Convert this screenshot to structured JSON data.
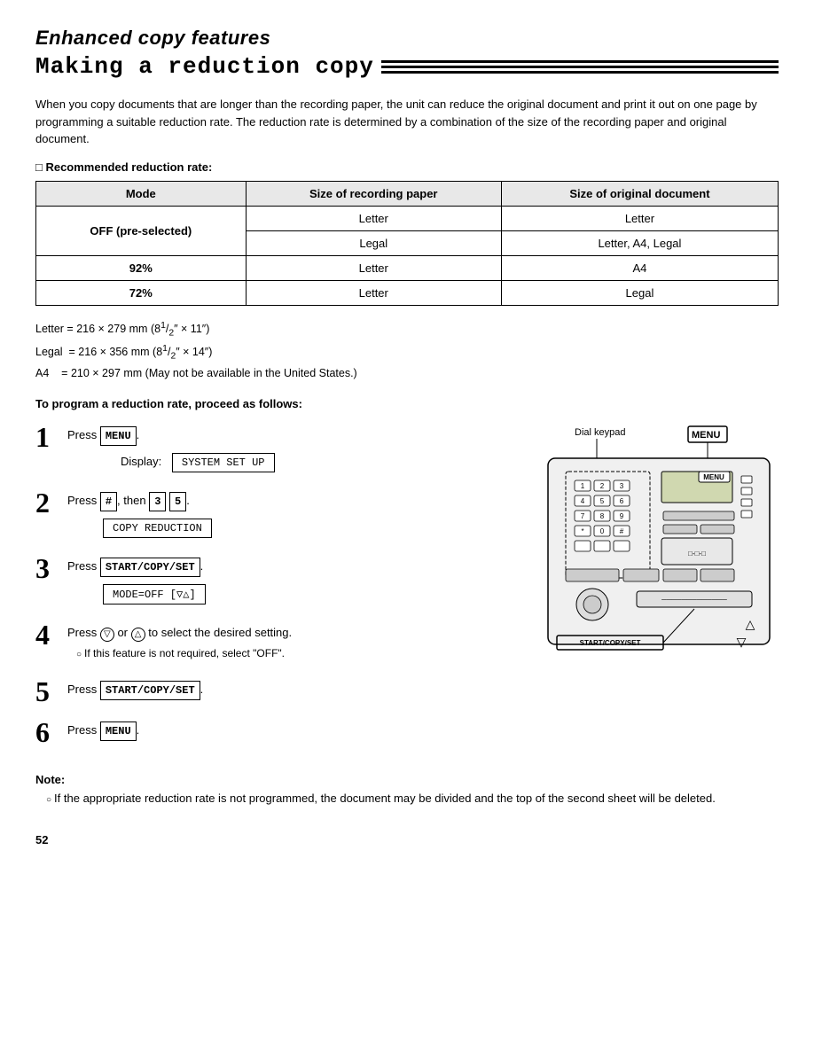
{
  "header": {
    "italic_title": "Enhanced copy features",
    "main_title": "Making a reduction copy"
  },
  "intro": {
    "text": "When you copy documents that are longer than the recording paper, the unit can reduce the original document and print it out on one page by programming a suitable reduction rate. The reduction rate is determined by a combination of the size of the recording paper and original document."
  },
  "recommended_section": {
    "heading": "□ Recommended reduction rate:"
  },
  "table": {
    "headers": [
      "Mode",
      "Size of recording paper",
      "Size of original document"
    ],
    "rows": [
      {
        "mode": "OFF (pre-selected)",
        "mode_rowspan": 2,
        "paper": "Letter",
        "original": "Letter"
      },
      {
        "mode": null,
        "paper": "Legal",
        "original": "Letter, A4, Legal"
      },
      {
        "mode": "92%",
        "paper": "Letter",
        "original": "A4"
      },
      {
        "mode": "72%",
        "paper": "Letter",
        "original": "Legal"
      }
    ]
  },
  "footnotes": [
    "Letter = 216 × 279 mm (8¹⁄₂″ × 11″)",
    "Legal  = 216 × 356 mm (8¹⁄₂″ × 14″)",
    "A4     = 210 × 297 mm (May not be available in the United States.)"
  ],
  "instructions_heading": "To program a reduction rate, proceed as follows:",
  "steps": [
    {
      "number": "1",
      "text_parts": [
        "Press ",
        "MENU",
        "."
      ],
      "display_indent": true,
      "display_label": "Display:",
      "display_text": "SYSTEM SET UP"
    },
    {
      "number": "2",
      "text_parts": [
        "Press ",
        "#",
        ", then ",
        "3",
        " ",
        "5",
        "."
      ],
      "display_indent": false,
      "display_text": "COPY REDUCTION"
    },
    {
      "number": "3",
      "text_parts": [
        "Press ",
        "START/COPY/SET",
        "."
      ],
      "display_indent": false,
      "display_text": "MODE=OFF    [▽△]"
    },
    {
      "number": "4",
      "text_parts": [
        "Press ",
        "▽",
        " or ",
        "△",
        " to select the desired setting."
      ],
      "sub_note": "If this feature is not required, select \"OFF\".",
      "display_text": null
    },
    {
      "number": "5",
      "text_parts": [
        "Press ",
        "START/COPY/SET",
        "."
      ],
      "display_text": null
    },
    {
      "number": "6",
      "text_parts": [
        "Press ",
        "MENU",
        "."
      ],
      "display_text": null
    }
  ],
  "diagram": {
    "dial_keypad_label": "Dial keypad",
    "menu_label": "MENU",
    "start_copy_set_label": "START/COPY/SET"
  },
  "note": {
    "label": "Note:",
    "items": [
      "If the appropriate reduction rate is not programmed, the document may be divided and the top of the second sheet will be deleted."
    ]
  },
  "page_number": "52"
}
